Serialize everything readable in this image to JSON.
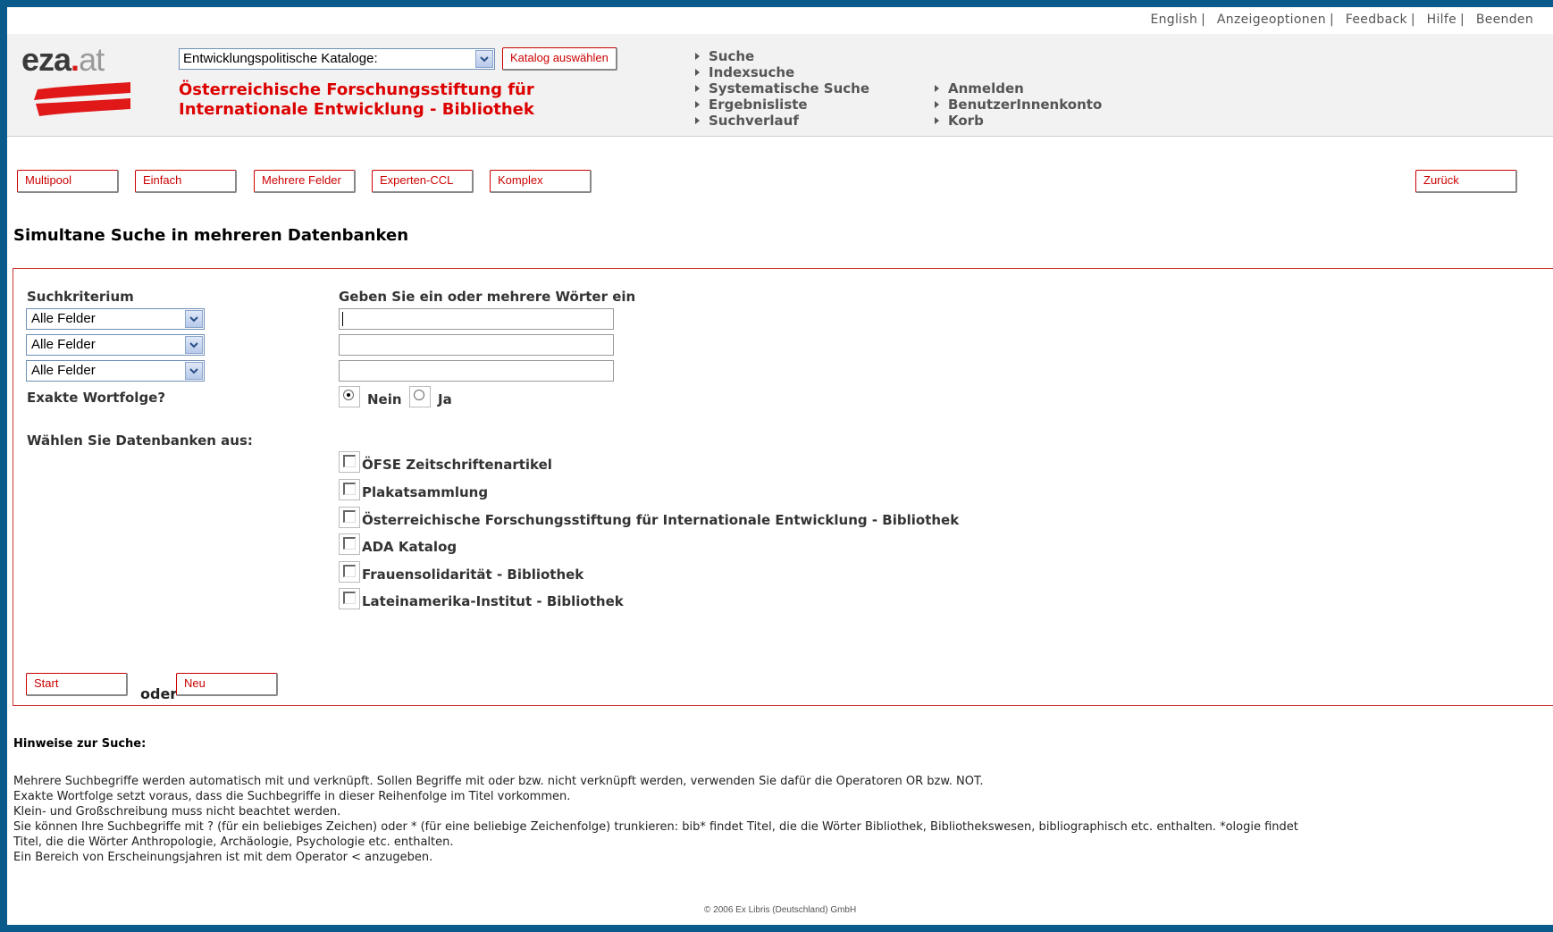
{
  "top_links": [
    "English",
    "Anzeigeoptionen",
    "Feedback",
    "Hilfe",
    "Beenden"
  ],
  "logo": {
    "name": "eza",
    "dot": ".",
    "tld": "at"
  },
  "catalog": {
    "select_value": "Entwicklungspolitische Kataloge:",
    "button_label": "Katalog auswählen"
  },
  "org_title": {
    "line1": "Österreichische Forschungsstiftung für",
    "line2": "Internationale Entwicklung - Bibliothek"
  },
  "nav_col1": [
    "Suche",
    "Indexsuche",
    "Systematische Suche",
    "Ergebnisliste",
    "Suchverlauf"
  ],
  "nav_col2": [
    "Anmelden",
    "BenutzerInnenkonto",
    "Korb"
  ],
  "tabs": [
    "Multipool",
    "Einfach",
    "Mehrere Felder",
    "Experten-CCL",
    "Komplex"
  ],
  "back_button": "Zurück",
  "page_heading": "Simultane Suche in mehreren Datenbanken",
  "form": {
    "criteria_label": "Suchkriterium",
    "words_label": "Geben Sie ein oder mehrere Wörter ein",
    "criteria_values": [
      "Alle Felder",
      "Alle Felder",
      "Alle Felder"
    ],
    "search_values": [
      "",
      "",
      ""
    ],
    "exact_label": "Exakte Wortfolge?",
    "exact_options": [
      "Nein",
      "Ja"
    ],
    "exact_selected": "Nein",
    "db_label": "Wählen Sie Datenbanken aus:",
    "databases": [
      "ÖFSE Zeitschriftenartikel",
      "Plakatsammlung",
      "Österreichische Forschungsstiftung für Internationale Entwicklung - Bibliothek",
      "ADA Katalog",
      "Frauensolidarität - Bibliothek",
      "Lateinamerika-Institut - Bibliothek"
    ],
    "start_label": "Start",
    "or_label": "oder",
    "new_label": "Neu"
  },
  "hints": {
    "title": "Hinweise zur Suche:",
    "line1": "Mehrere Suchbegriffe werden automatisch mit und verknüpft. Sollen Begriffe mit oder bzw. nicht verknüpft werden, verwenden Sie dafür die Operatoren OR bzw. NOT.",
    "line2": "Exakte Wortfolge setzt voraus, dass die Suchbegriffe in dieser Reihenfolge im Titel vorkommen.",
    "line3": "Klein- und Großschreibung muss nicht beachtet werden.",
    "line4": "Sie können Ihre Suchbegriffe mit ? (für ein beliebiges Zeichen) oder * (für eine beliebige Zeichenfolge) trunkieren: bib* findet Titel, die die Wörter Bibliothek, Bibliothekswesen, bibliographisch etc. enthalten. *ologie findet",
    "line5": "Titel, die die Wörter Anthropologie, Archäologie, Psychologie etc. enthalten.",
    "line6": "Ein Bereich von Erscheinungsjahren ist mit dem Operator < anzugeben."
  },
  "footer": "© 2006 Ex Libris (Deutschland) GmbH",
  "colors": {
    "accent_red": "#cc0000",
    "frame_blue": "#0b5a8c",
    "header_gray": "#f2f2f2"
  }
}
